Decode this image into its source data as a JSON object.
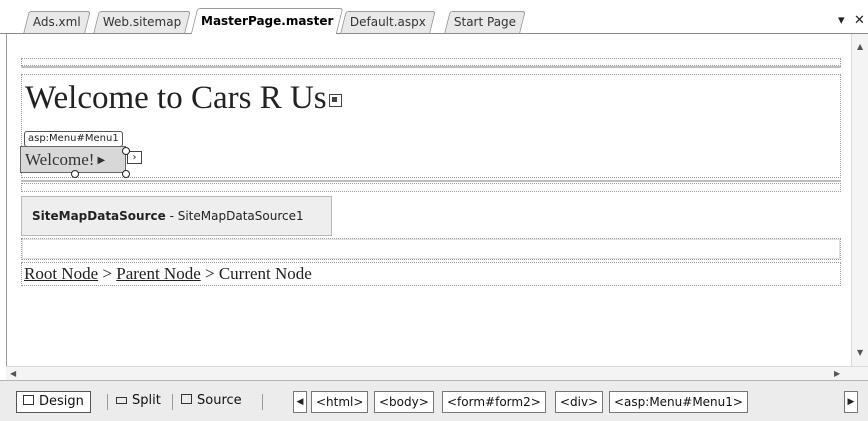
{
  "tabs": [
    {
      "label": "Ads.xml",
      "active": false
    },
    {
      "label": "Web.sitemap",
      "active": false
    },
    {
      "label": "MasterPage.master",
      "active": true
    },
    {
      "label": "Default.aspx",
      "active": false
    },
    {
      "label": "Start Page",
      "active": false
    }
  ],
  "tab_controls": {
    "dropdown": "▾",
    "close": "✕"
  },
  "design": {
    "page_title": "Welcome to Cars R Us",
    "menu": {
      "tag": "asp:Menu#Menu1",
      "item_label": "Welcome!",
      "item_arrow": "▶",
      "smart_tag": "›"
    },
    "sitemap_datasource": {
      "type_label": "SiteMapDataSource",
      "separator": " - ",
      "id_label": "SiteMapDataSource1"
    },
    "breadcrumb": {
      "root": "Root Node",
      "sep1": " > ",
      "parent": "Parent Node",
      "sep2": " > ",
      "current": "Current Node"
    }
  },
  "scrollbar_arrows": {
    "up": "▲",
    "down": "▼",
    "left": "◀",
    "right": "▶"
  },
  "bottom_bar": {
    "views": {
      "design": "Design",
      "split": "Split",
      "source": "Source"
    },
    "tag_nav": {
      "prev": "◀",
      "next": "▶"
    },
    "tag_path": [
      "<html>",
      "<body>",
      "<form#form2>",
      "<div>",
      "<asp:Menu#Menu1>"
    ]
  },
  "colors": {
    "accent": "#d8d8d8",
    "border": "#9a9a9a",
    "text": "#222222"
  }
}
